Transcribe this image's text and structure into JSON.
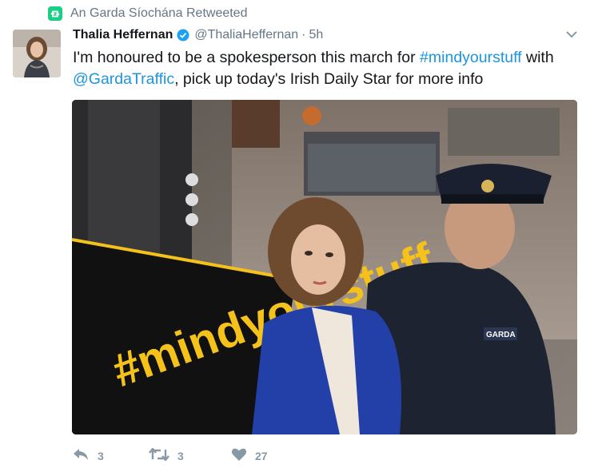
{
  "context": {
    "retweeted_by": "An Garda Síochána Retweeted",
    "icon": "retweet-icon"
  },
  "tweet": {
    "author_name": "Thalia Heffernan",
    "verified": true,
    "handle": "@ThaliaHeffernan",
    "separator": "·",
    "time": "5h",
    "text_1": "I'm honoured to be a spokesperson this march for ",
    "hashtag": "#mindyourstuff",
    "text_2": " with ",
    "mention": "@GardaTraffic",
    "text_3": ", pick up today's Irish Daily Star for more info"
  },
  "media": {
    "sign_text": "#mindyourstuff",
    "badge_text": "GARDA"
  },
  "actions": {
    "reply_count": "3",
    "retweet_count": "3",
    "like_count": "27"
  },
  "colors": {
    "link": "#1b95e0",
    "retweet_green": "#19cf86",
    "muted": "#657786",
    "action_grey": "#8899a6",
    "sign_yellow": "#f5c21b"
  }
}
